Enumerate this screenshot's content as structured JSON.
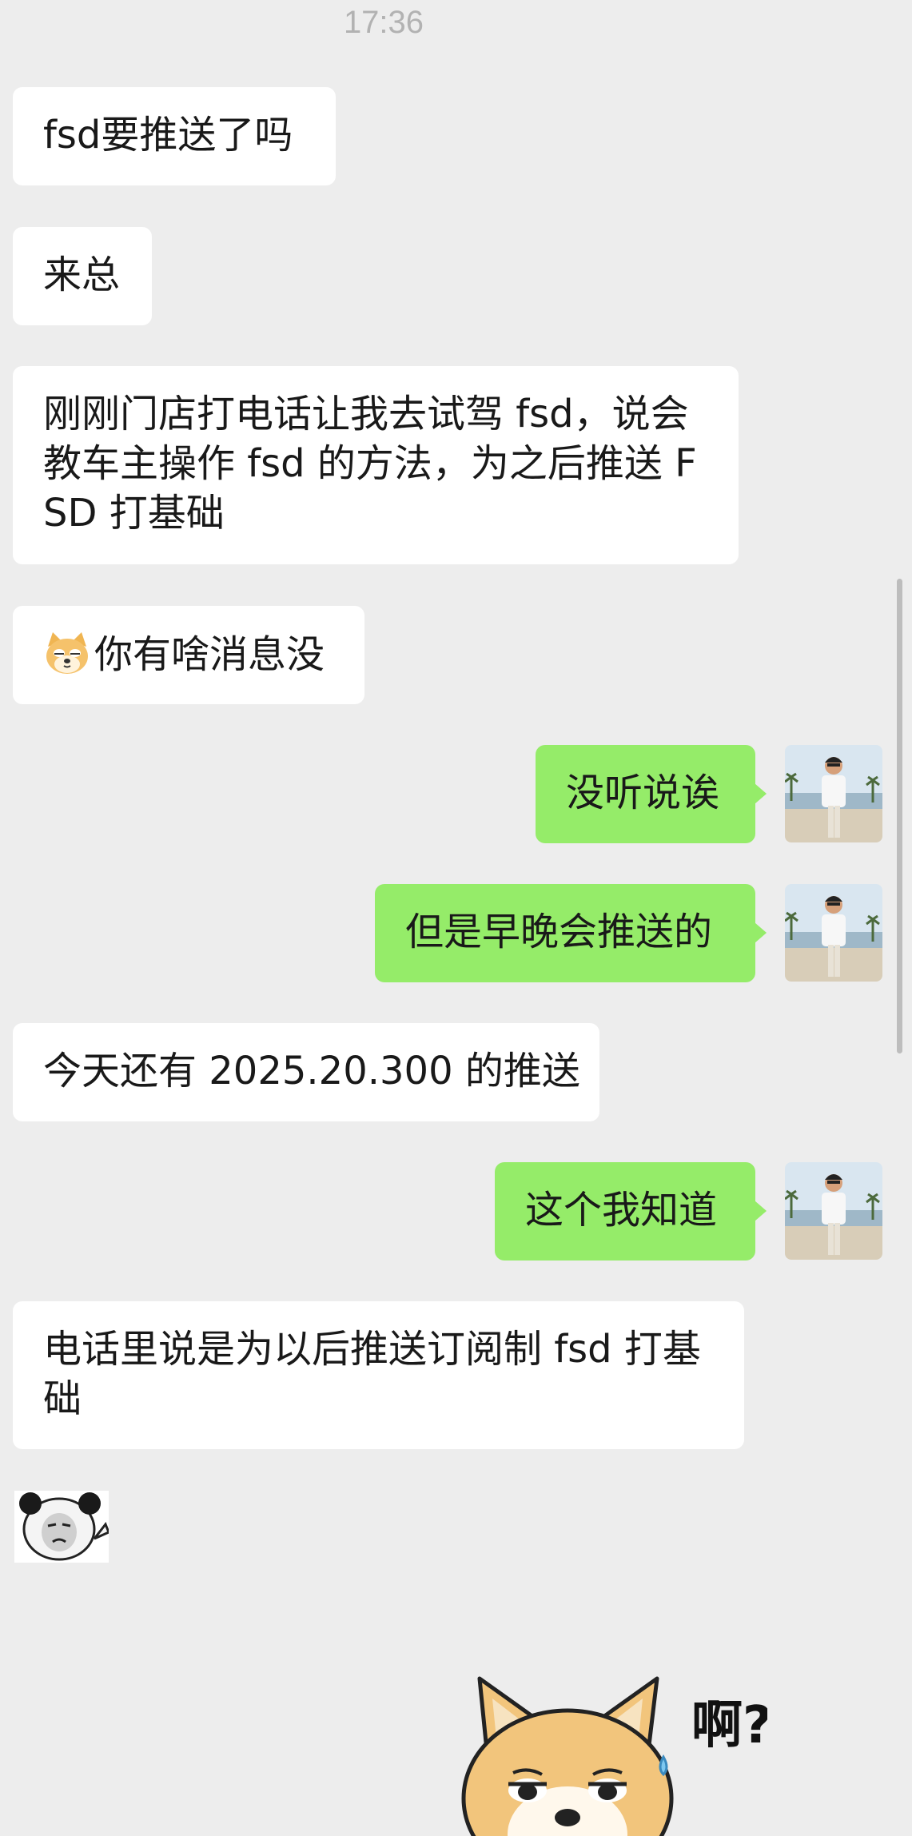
{
  "chat": {
    "timestamp": "17:36",
    "messages": [
      {
        "from": "other",
        "text": "fsd要推送了吗"
      },
      {
        "from": "other",
        "text": "来总"
      },
      {
        "from": "other",
        "text": "刚刚门店打电话让我去试驾 fsd，说会教车主操作 fsd 的方法，为之后推送 FSD 打基础"
      },
      {
        "from": "other",
        "text": "你有啥消息没",
        "emoji": "doge-face-icon"
      },
      {
        "from": "me",
        "text": "没听说诶"
      },
      {
        "from": "me",
        "text": "但是早晚会推送的"
      },
      {
        "from": "other",
        "text": "今天还有 2025.20.300 的推送"
      },
      {
        "from": "me",
        "text": "这个我知道"
      },
      {
        "from": "other",
        "text": "电话里说是为以后推送订阅制 fsd 打基础"
      },
      {
        "from": "other",
        "sticker": "panda-meme-sticker"
      },
      {
        "from": "me",
        "sticker": "doge-surprised-sticker",
        "sticker_text": "啊?!"
      }
    ]
  },
  "colors": {
    "background": "#ededed",
    "incoming_bubble": "#ffffff",
    "outgoing_bubble": "#95ec69",
    "text": "#191919"
  }
}
